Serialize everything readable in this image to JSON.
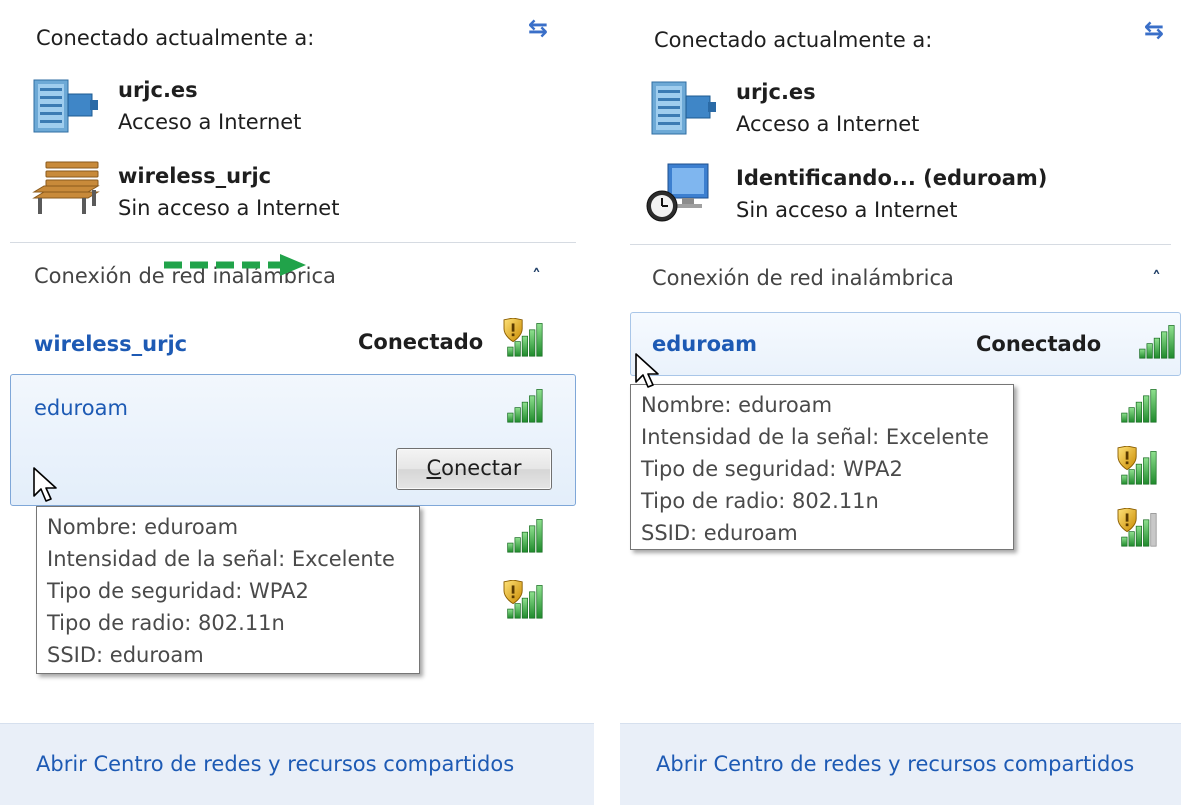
{
  "left": {
    "header": "Conectado actualmente a:",
    "connections": [
      {
        "name": "urjc.es",
        "status": "Acceso a Internet",
        "icon": "network-building-icon"
      },
      {
        "name": "wireless_urjc",
        "status": "Sin acceso a Internet",
        "icon": "park-bench-icon"
      }
    ],
    "section_title": "Conexión de red inalámbrica",
    "networks": [
      {
        "name": "wireless_urjc",
        "state": "Conectado",
        "secured": true
      },
      {
        "name": "eduroam",
        "secured": false
      }
    ],
    "connect_button": {
      "underlined": "C",
      "rest": "onectar"
    },
    "tooltip": [
      "Nombre: eduroam",
      "Intensidad de la señal: Excelente",
      "Tipo de seguridad: WPA2",
      "Tipo de radio: 802.11n",
      "SSID: eduroam"
    ],
    "footer_link": "Abrir Centro de redes y recursos compartidos"
  },
  "right": {
    "header": "Conectado actualmente a:",
    "connections": [
      {
        "name": "urjc.es",
        "status": "Acceso a Internet",
        "icon": "network-building-icon"
      },
      {
        "name": "Identificando... (eduroam)",
        "status": "Sin acceso a Internet",
        "icon": "identifying-network-icon"
      }
    ],
    "section_title": "Conexión de red inalámbrica",
    "networks": [
      {
        "name": "eduroam",
        "state": "Conectado",
        "secured": false
      }
    ],
    "tooltip": [
      "Nombre: eduroam",
      "Intensidad de la señal: Excelente",
      "Tipo de seguridad: WPA2",
      "Tipo de radio: 802.11n",
      "SSID: eduroam"
    ],
    "footer_link": "Abrir Centro de redes y recursos compartidos"
  },
  "colors": {
    "link": "#1d5ab4",
    "highlight_border": "#7fa7d8",
    "footer_bg": "#e9eff8",
    "signal_green": "#2ea23a",
    "arrow_green": "#21a34a"
  }
}
